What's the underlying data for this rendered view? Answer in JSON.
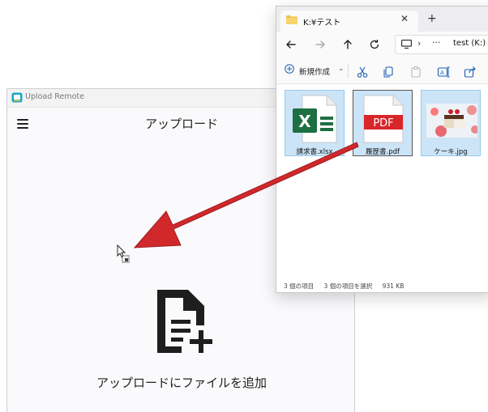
{
  "upload_window": {
    "title": "Upload Remote",
    "heading": "アップロード",
    "add_file_label": "アップロードにファイルを追加",
    "icons": {
      "menu": "hamburger-menu-icon",
      "add_file": "add-file-icon",
      "app": "upload-remote-app-icon"
    }
  },
  "explorer": {
    "tab_title": "K:¥テスト",
    "tab_close": "✕",
    "new_tab": "+",
    "address": {
      "chevron": "›",
      "more": "···",
      "path": "test (K:)"
    },
    "commands": {
      "new_label": "新規作成",
      "new_chevron": "⌄"
    },
    "files": [
      {
        "name": "請求書.xlsx",
        "type": "excel",
        "badge": "X",
        "selected": true,
        "focused": false
      },
      {
        "name": "履歴書.pdf",
        "type": "pdf",
        "badge": "PDF",
        "selected": true,
        "focused": true
      },
      {
        "name": "ケーキ.jpg",
        "type": "image",
        "selected": true,
        "focused": false
      }
    ],
    "status": {
      "items": "3 個の項目",
      "selection": "3 個の項目を選択",
      "size": "931 KB"
    }
  },
  "colors": {
    "arrow": "#d1282c",
    "excel_green": "#1d6f42",
    "pdf_red": "#d9262b",
    "selection": "#cce4f7"
  }
}
